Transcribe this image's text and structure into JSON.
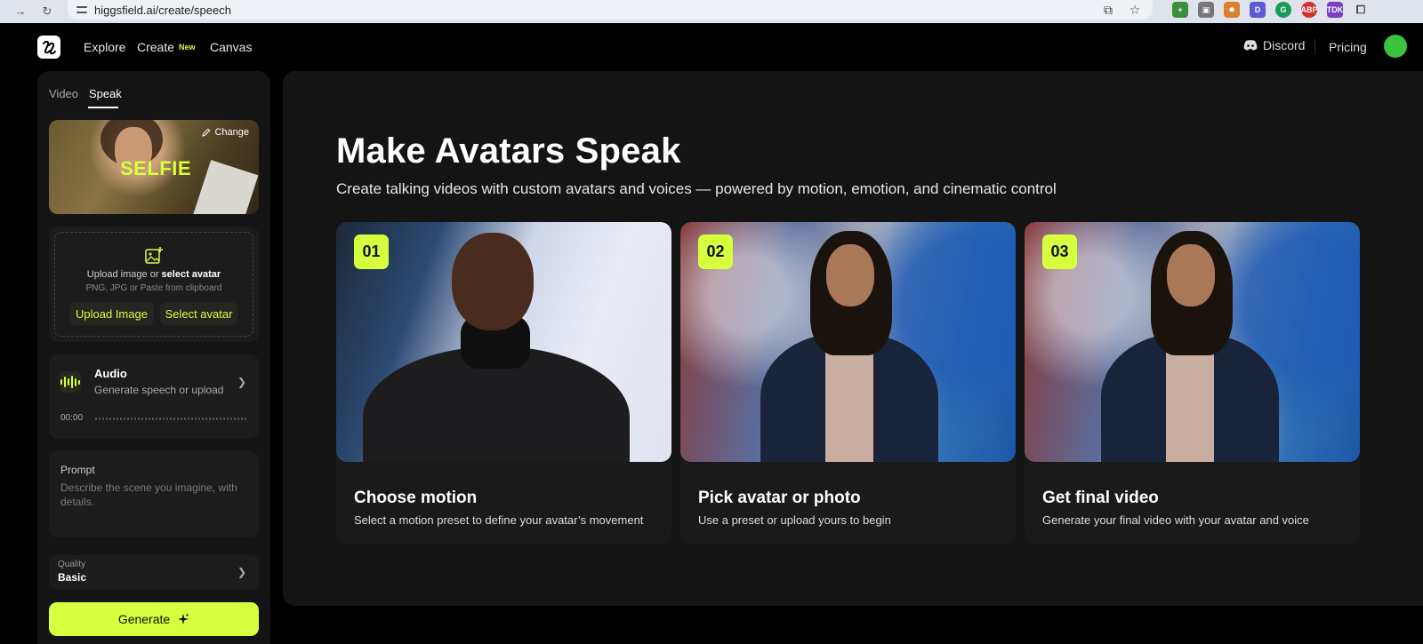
{
  "browser": {
    "url": "higgsfield.ai/create/speech"
  },
  "nav": {
    "links": [
      "Explore",
      "Create",
      "Canvas"
    ],
    "new_badge": "New",
    "discord": "Discord",
    "pricing": "Pricing"
  },
  "sidebar": {
    "tabs": [
      "Video",
      "Speak"
    ],
    "active_tab": "Speak",
    "selfie": {
      "overlay_text": "SELFIE",
      "change_label": "Change"
    },
    "upload": {
      "line1_prefix": "Upload image or ",
      "line1_link": "select avatar",
      "line2": "PNG, JPG or Paste from clipboard",
      "upload_button": "Upload Image",
      "select_button": "Select avatar"
    },
    "audio": {
      "title": "Audio",
      "subtitle": "Generate speech or upload",
      "time": "00:00"
    },
    "prompt": {
      "label": "Prompt",
      "placeholder": "Describe the scene you imagine, with details."
    },
    "quality": {
      "label": "Quality",
      "value": "Basic"
    },
    "generate_label": "Generate"
  },
  "main": {
    "headline": "Make Avatars Speak",
    "subheadline": "Create talking videos with custom avatars and voices — powered by motion, emotion, and cinematic control",
    "steps": [
      {
        "number": "01",
        "title": "Choose motion",
        "description": "Select a motion preset to define your avatar’s movement"
      },
      {
        "number": "02",
        "title": "Pick avatar or photo",
        "description": "Use a preset or upload yours to begin"
      },
      {
        "number": "03",
        "title": "Get final video",
        "description": "Generate your final video with your avatar and voice"
      }
    ]
  },
  "colors": {
    "accent": "#d6ff3d",
    "panel": "#141414",
    "card": "#1c1c1c"
  }
}
